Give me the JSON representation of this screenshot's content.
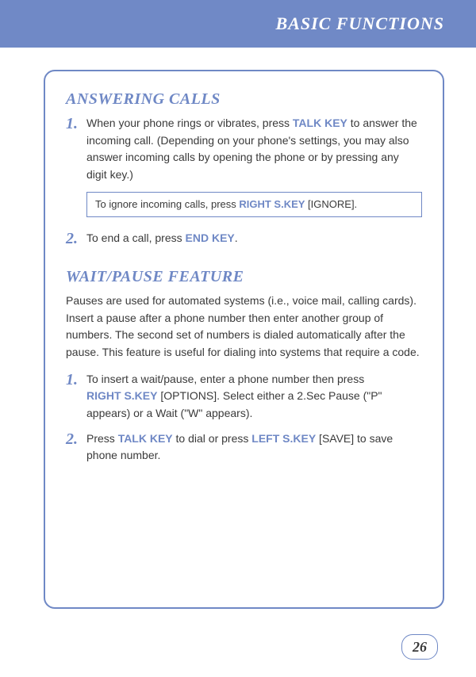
{
  "header": {
    "title": "BASIC FUNCTIONS"
  },
  "page_number": "26",
  "sections": {
    "answering": {
      "heading": "ANSWERING CALLS",
      "item1_num": "1.",
      "item1_a": "When your phone rings or vibrates, press ",
      "item1_key1": "TALK KEY",
      "item1_b": " to answer the incoming call. (Depending on your phone's settings, you may also answer incoming calls by opening the phone or by pressing any digit key.)",
      "note_a": "To ignore incoming calls, press ",
      "note_key": "RIGHT S.KEY",
      "note_b": " [IGNORE].",
      "item2_num": "2.",
      "item2_a": "To end a call, press ",
      "item2_key1": "END KEY",
      "item2_b": "."
    },
    "waitpause": {
      "heading": "WAIT/PAUSE FEATURE",
      "intro": "Pauses are used for automated systems (i.e., voice mail, calling cards). Insert a pause after a phone number then enter another group of numbers. The second set of numbers is dialed automatically after the pause. This feature is useful for dialing into systems that require a code.",
      "item1_num": "1.",
      "item1_a": "To insert a wait/pause, enter a phone number then press ",
      "item1_key1": "RIGHT S.KEY",
      "item1_b": " [OPTIONS]. Select either a 2.Sec Pause (\"P\" appears) or a Wait (\"W\" appears).",
      "item2_num": "2.",
      "item2_a": "Press ",
      "item2_key1": "TALK KEY",
      "item2_b": " to dial or press ",
      "item2_key2": "LEFT S.KEY",
      "item2_c": " [SAVE] to save phone number."
    }
  }
}
